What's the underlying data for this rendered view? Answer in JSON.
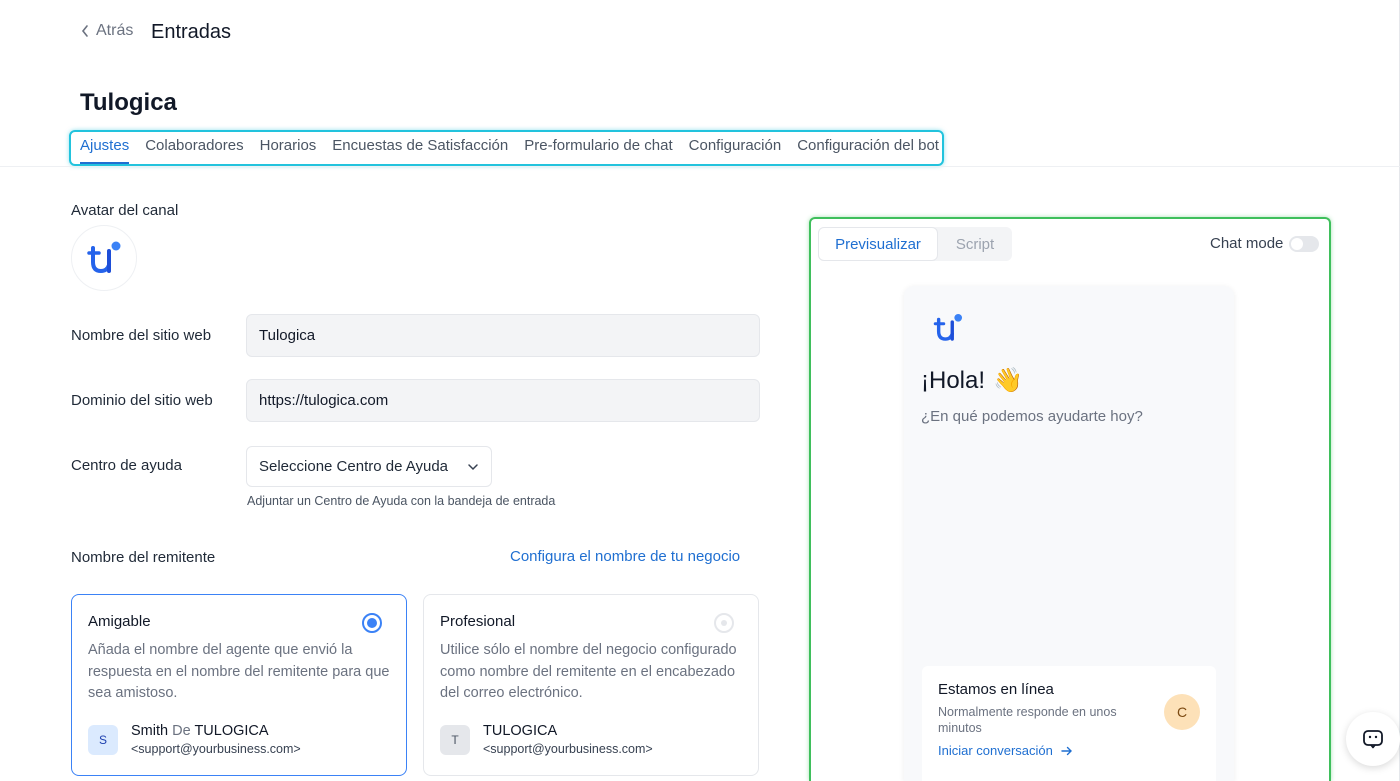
{
  "header": {
    "back_label": "Atrás",
    "title": "Entradas"
  },
  "inbox": {
    "name": "Tulogica"
  },
  "tabs": [
    {
      "label": "Ajustes",
      "active": true
    },
    {
      "label": "Colaboradores"
    },
    {
      "label": "Horarios"
    },
    {
      "label": "Encuestas de Satisfacción"
    },
    {
      "label": "Pre-formulario de chat"
    },
    {
      "label": "Configuración"
    },
    {
      "label": "Configuración del bot"
    }
  ],
  "form": {
    "avatar_label": "Avatar del canal",
    "site_name": {
      "label": "Nombre del sitio web",
      "value": "Tulogica"
    },
    "site_domain": {
      "label": "Dominio del sitio web",
      "value": "https://tulogica.com"
    },
    "help_center": {
      "label": "Centro de ayuda",
      "selected": "Seleccione Centro de Ayuda",
      "hint": "Adjuntar un Centro de Ayuda con la bandeja de entrada"
    },
    "sender": {
      "label": "Nombre del remitente",
      "configure_link": "Configura el nombre de tu negocio",
      "options": [
        {
          "title": "Amigable",
          "description": "Añada el nombre del agente que envió la respuesta en el nombre del remitente para que sea amistoso.",
          "avatar": "S",
          "name_main": "Smith",
          "name_sep": "De",
          "name_org": "TULOGICA",
          "email": "<support@yourbusiness.com>",
          "selected": true
        },
        {
          "title": "Profesional",
          "description": "Utilice sólo el nombre del negocio configurado como nombre del remitente en el encabezado del correo electrónico.",
          "avatar": "T",
          "name_main": "TULOGICA",
          "email": "<support@yourbusiness.com>",
          "selected": false
        }
      ]
    }
  },
  "preview": {
    "tab_preview": "Previsualizar",
    "tab_script": "Script",
    "chat_mode_label": "Chat mode",
    "chat_mode_on": false,
    "greeting": "¡Hola!",
    "greeting_emoji": "👋",
    "subtitle": "¿En qué podemos ayudarte hoy?",
    "online_title": "Estamos en línea",
    "online_desc": "Normalmente responde en unos minutos",
    "online_avatar": "C",
    "start_cta": "Iniciar conversación"
  },
  "colors": {
    "accent": "#1f6fd1",
    "tabs_highlight": "#22c3dd",
    "preview_highlight": "#3fbf5c",
    "logo_blue": "#2563eb"
  },
  "icons": {
    "back": "chevron-left-icon",
    "select": "chevron-down-icon",
    "cta": "arrow-right-icon",
    "fab": "chat-bubble-icon"
  }
}
